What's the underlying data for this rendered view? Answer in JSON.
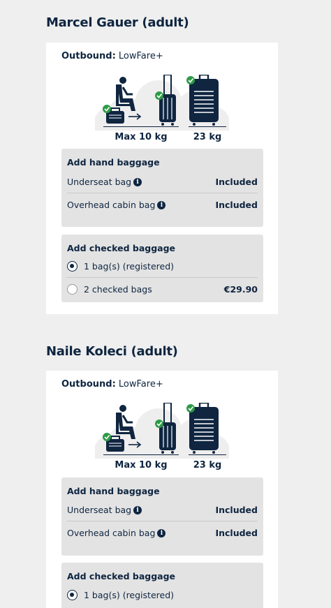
{
  "passengers": [
    {
      "name": "Marcel Gauer (adult)",
      "outbound_label": "Outbound:",
      "fare": "LowFare+",
      "hand_weight": "Max 10 kg",
      "checked_weight": "23 kg",
      "hand_baggage": {
        "title": "Add hand baggage",
        "items": [
          {
            "label": "Underseat bag",
            "value": "Included"
          },
          {
            "label": "Overhead cabin bag",
            "value": "Included"
          }
        ]
      },
      "checked_baggage": {
        "title": "Add checked baggage",
        "options": [
          {
            "label": "1 bag(s) (registered)",
            "price": "",
            "selected": true
          },
          {
            "label": "2 checked bags",
            "price": "€29.90",
            "selected": false
          }
        ]
      }
    },
    {
      "name": "Naile Koleci (adult)",
      "outbound_label": "Outbound:",
      "fare": "LowFare+",
      "hand_weight": "Max 10 kg",
      "checked_weight": "23 kg",
      "hand_baggage": {
        "title": "Add hand baggage",
        "items": [
          {
            "label": "Underseat bag",
            "value": "Included"
          },
          {
            "label": "Overhead cabin bag",
            "value": "Included"
          }
        ]
      },
      "checked_baggage": {
        "title": "Add checked baggage",
        "options": [
          {
            "label": "1 bag(s) (registered)",
            "price": "",
            "selected": true
          }
        ]
      }
    }
  ],
  "icons": {
    "info": "i"
  },
  "colors": {
    "navy": "#0f2540",
    "check_green": "#2e9b46",
    "card_bg": "#ffffff",
    "panel_bg": "#e3e3e3",
    "page_bg": "#efefef"
  }
}
